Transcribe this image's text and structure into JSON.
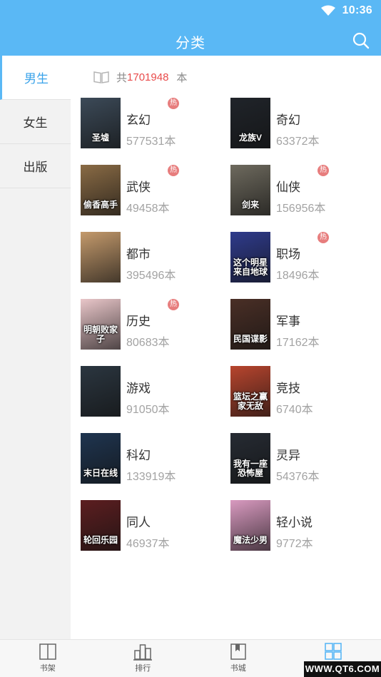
{
  "status_bar": {
    "time": "10:36"
  },
  "header": {
    "title": "分类"
  },
  "sidebar": {
    "items": [
      {
        "label": "男生",
        "active": true
      },
      {
        "label": "女生",
        "active": false
      },
      {
        "label": "出版",
        "active": false
      }
    ]
  },
  "summary": {
    "prefix": "共",
    "total": "1701948",
    "unit": "本"
  },
  "categories": [
    {
      "name": "玄幻",
      "count": "577531本",
      "hot": true,
      "badge": "热",
      "cover_text": "圣墟",
      "cover_color": "#3c4a58"
    },
    {
      "name": "奇幻",
      "count": "63372本",
      "hot": false,
      "badge": "",
      "cover_text": "龙族V",
      "cover_color": "#20242a"
    },
    {
      "name": "武侠",
      "count": "49458本",
      "hot": true,
      "badge": "热",
      "cover_text": "偷香高手",
      "cover_color": "#8a6b45"
    },
    {
      "name": "仙侠",
      "count": "156956本",
      "hot": true,
      "badge": "热",
      "cover_text": "剑来",
      "cover_color": "#6e6a5e"
    },
    {
      "name": "都市",
      "count": "395496本",
      "hot": false,
      "badge": "",
      "cover_text": "",
      "cover_color": "#c49a6c"
    },
    {
      "name": "职场",
      "count": "18496本",
      "hot": true,
      "badge": "热",
      "cover_text": "这个明星来自地球",
      "cover_color": "#2f3b8c"
    },
    {
      "name": "历史",
      "count": "80683本",
      "hot": true,
      "badge": "热",
      "cover_text": "明朝败家子",
      "cover_color": "#e9c6c9"
    },
    {
      "name": "军事",
      "count": "17162本",
      "hot": false,
      "badge": "",
      "cover_text": "民国谍影",
      "cover_color": "#4a2f26"
    },
    {
      "name": "游戏",
      "count": "91050本",
      "hot": false,
      "badge": "",
      "cover_text": "",
      "cover_color": "#2b3640"
    },
    {
      "name": "竞技",
      "count": "6740本",
      "hot": false,
      "badge": "",
      "cover_text": "篮坛之赢家无敌",
      "cover_color": "#b8452e"
    },
    {
      "name": "科幻",
      "count": "133919本",
      "hot": false,
      "badge": "",
      "cover_text": "末日在线",
      "cover_color": "#1f3550"
    },
    {
      "name": "灵异",
      "count": "54376本",
      "hot": false,
      "badge": "",
      "cover_text": "我有一座恐怖屋",
      "cover_color": "#262b33"
    },
    {
      "name": "同人",
      "count": "46937本",
      "hot": false,
      "badge": "",
      "cover_text": "轮回乐园",
      "cover_color": "#5c1e20"
    },
    {
      "name": "轻小说",
      "count": "9772本",
      "hot": false,
      "badge": "",
      "cover_text": "魔法少男",
      "cover_color": "#d99ac0"
    }
  ],
  "bottom_nav": {
    "items": [
      {
        "label": "书架",
        "icon": "bookshelf-icon",
        "active": false
      },
      {
        "label": "排行",
        "icon": "ranking-icon",
        "active": false
      },
      {
        "label": "书城",
        "icon": "bookstore-icon",
        "active": false
      },
      {
        "label": "",
        "icon": "category-grid-icon",
        "active": true
      }
    ]
  },
  "watermark": "WWW.QT6.COM",
  "colors": {
    "accent": "#5ab8f5",
    "highlight": "#e94b4b",
    "hot_badge": "#e77d7d"
  }
}
